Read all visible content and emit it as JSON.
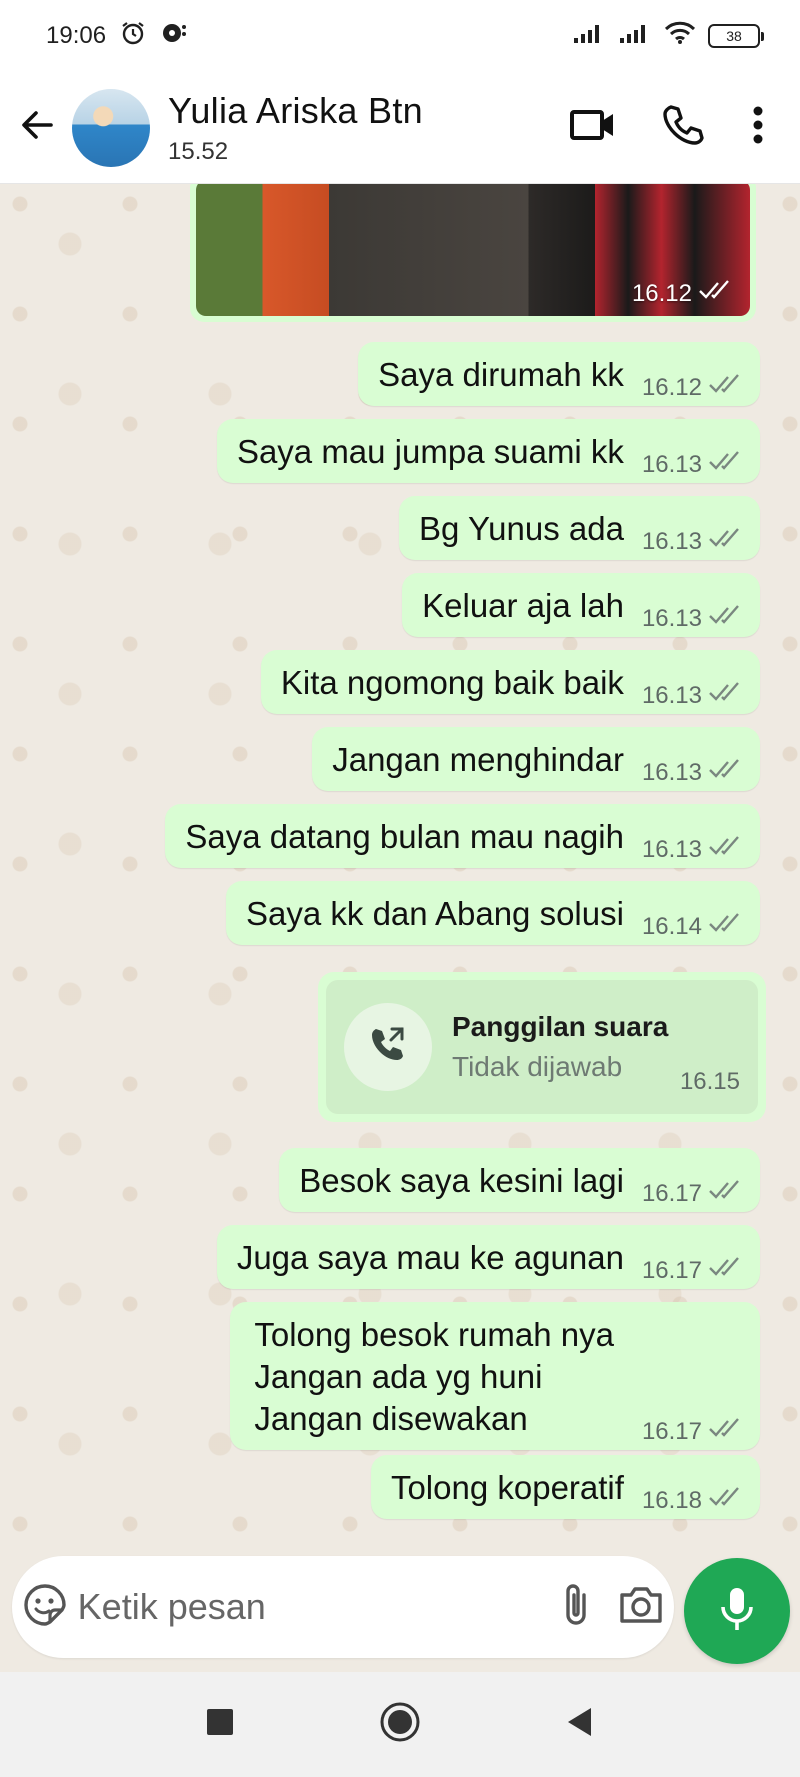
{
  "status_bar": {
    "time": "19:06",
    "battery": "38",
    "icons": [
      "alarm-icon",
      "notification-icon",
      "signal-icon",
      "signal-icon",
      "wifi-icon",
      "battery-icon"
    ]
  },
  "header": {
    "contact_name": "Yulia Ariska Btn",
    "contact_status": "15.52",
    "icons": [
      "back-arrow-icon",
      "video-call-icon",
      "phone-icon",
      "more-vert-icon"
    ]
  },
  "photo_message": {
    "time": "16.12"
  },
  "messages": [
    {
      "text": "Saya dirumah kk",
      "time": "16.12"
    },
    {
      "text": "Saya mau jumpa suami kk",
      "time": "16.13"
    },
    {
      "text": "Bg Yunus ada",
      "time": "16.13"
    },
    {
      "text": "Keluar aja lah",
      "time": "16.13"
    },
    {
      "text": "Kita ngomong baik baik",
      "time": "16.13"
    },
    {
      "text": "Jangan menghindar",
      "time": "16.13"
    },
    {
      "text": "Saya datang bulan mau nagih",
      "time": "16.13"
    },
    {
      "text": "Saya kk dan Abang solusi",
      "time": "16.14"
    },
    {
      "text": "Besok saya kesini lagi",
      "time": "16.17"
    },
    {
      "text": "Juga saya mau ke agunan",
      "time": "16.17"
    },
    {
      "text": "Tolong besok rumah nya\nJangan ada yg huni\nJangan disewakan",
      "time": "16.17"
    },
    {
      "text": "Tolong koperatif",
      "time": "16.18"
    }
  ],
  "call_event": {
    "title": "Panggilan suara",
    "subtitle": "Tidak dijawab",
    "time": "16.15"
  },
  "composer": {
    "placeholder": "Ketik pesan"
  },
  "colors": {
    "bubble_out": "#d9fdd3",
    "chat_bg": "#efeae2",
    "accent_green": "#1fa855"
  }
}
